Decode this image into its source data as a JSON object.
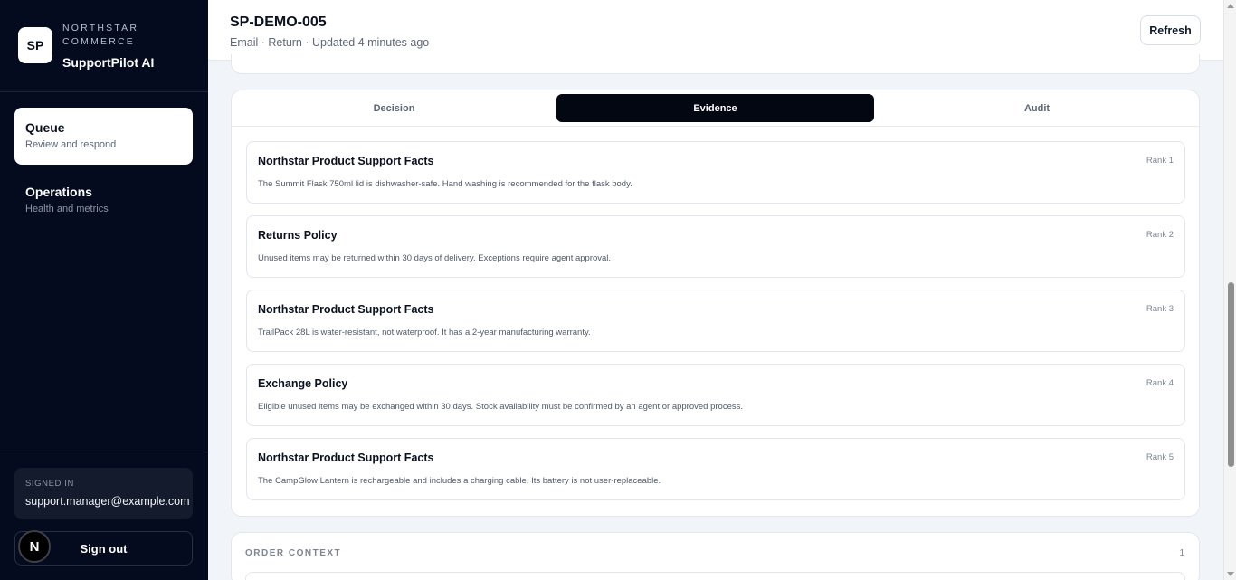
{
  "sidebar": {
    "logo_text": "SP",
    "org_name": "NORTHSTAR COMMERCE",
    "app_name": "SupportPilot AI",
    "nav": [
      {
        "title": "Queue",
        "subtitle": "Review and respond"
      },
      {
        "title": "Operations",
        "subtitle": "Health and metrics"
      }
    ],
    "signed_in_label": "SIGNED IN",
    "user_email": "support.manager@example.com",
    "sign_out_label": "Sign out",
    "avatar_letter": "N"
  },
  "header": {
    "ticket_id": "SP-DEMO-005",
    "meta": "Email · Return · Updated 4 minutes ago",
    "refresh_label": "Refresh"
  },
  "tabs": [
    {
      "label": "Decision",
      "active": false
    },
    {
      "label": "Evidence",
      "active": true
    },
    {
      "label": "Audit",
      "active": false
    }
  ],
  "evidence": [
    {
      "title": "Northstar Product Support Facts",
      "rank": "Rank 1",
      "text": "The Summit Flask 750ml lid is dishwasher-safe. Hand washing is recommended for the flask body."
    },
    {
      "title": "Returns Policy",
      "rank": "Rank 2",
      "text": "Unused items may be returned within 30 days of delivery. Exceptions require agent approval."
    },
    {
      "title": "Northstar Product Support Facts",
      "rank": "Rank 3",
      "text": "TrailPack 28L is water-resistant, not waterproof. It has a 2-year manufacturing warranty."
    },
    {
      "title": "Exchange Policy",
      "rank": "Rank 4",
      "text": "Eligible unused items may be exchanged within 30 days. Stock availability must be confirmed by an agent or approved process."
    },
    {
      "title": "Northstar Product Support Facts",
      "rank": "Rank 5",
      "text": "The CampGlow Lantern is rechargeable and includes a charging cable. Its battery is not user-replaceable."
    }
  ],
  "order_context": {
    "title": "ORDER CONTEXT",
    "count": "1"
  },
  "colors": {
    "sidebar_bg": "#040b1f",
    "active_tab_bg": "#030712",
    "page_bg": "#f1f4f8"
  }
}
